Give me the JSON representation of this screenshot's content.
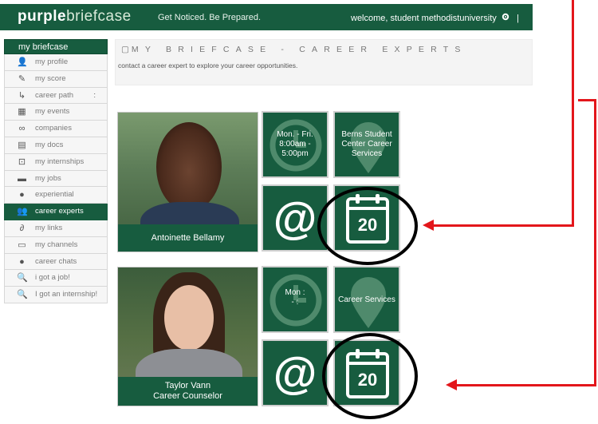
{
  "topbar": {
    "logo_part1": "purple",
    "logo_part2": "briefcase",
    "tagline": "Get Noticed. Be Prepared.",
    "welcome": "welcome, student methodistuniversity",
    "separator": "|"
  },
  "sidebar": {
    "header": "my briefcase",
    "items": [
      {
        "label": "my profile",
        "icon": "person-icon"
      },
      {
        "label": "my score",
        "icon": "edit-icon"
      },
      {
        "label": "career path",
        "icon": "path-icon",
        "suffix": ":"
      },
      {
        "label": "my events",
        "icon": "calendar-icon"
      },
      {
        "label": "companies",
        "icon": "binoculars-icon"
      },
      {
        "label": "my docs",
        "icon": "document-icon"
      },
      {
        "label": "my internships",
        "icon": "briefcase-icon"
      },
      {
        "label": "my jobs",
        "icon": "toolbox-icon"
      },
      {
        "label": "experiential",
        "icon": "brain-icon"
      },
      {
        "label": "career experts",
        "icon": "people-icon",
        "active": true
      },
      {
        "label": "my links",
        "icon": "link-icon"
      },
      {
        "label": "my channels",
        "icon": "tv-icon"
      },
      {
        "label": "career chats",
        "icon": "chat-icon"
      },
      {
        "label": "i got a job!",
        "icon": "magnifier-icon"
      },
      {
        "label": "I got an internship!",
        "icon": "magnifier-icon"
      }
    ]
  },
  "panel": {
    "title": "MY BRIEFCASE - CAREER EXPERTS",
    "subtitle": "contact a career expert to explore your career opportunities."
  },
  "experts": [
    {
      "name": "Antoinette Bellamy",
      "title": "",
      "hours": "Mon. - Fri. 8:00am - 5:00pm",
      "location": "Berns Student Center Career Services",
      "email_icon": "@",
      "calendar_day": "20"
    },
    {
      "name": "Taylor Vann",
      "title": "Career Counselor",
      "hours": "Mon : - :",
      "location": "Career Services",
      "email_icon": "@",
      "calendar_day": "20"
    }
  ],
  "colors": {
    "brand_green": "#175c3f",
    "annotation_red": "#e3161b",
    "annotation_circle": "#000000"
  }
}
